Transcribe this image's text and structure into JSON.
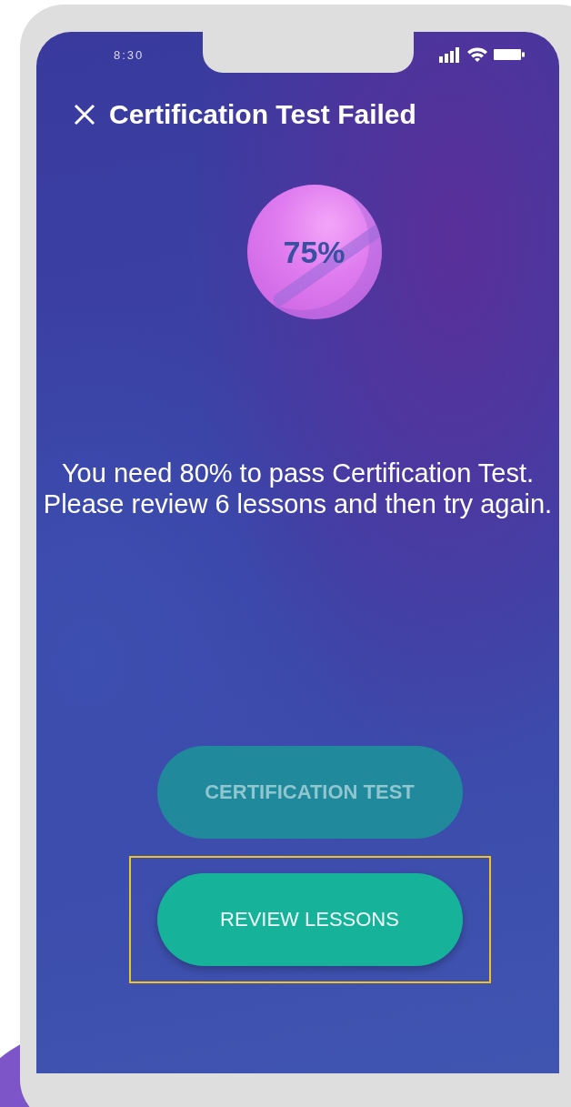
{
  "status_bar": {
    "time": "8:30"
  },
  "header": {
    "title": "Certification Test Failed"
  },
  "score": {
    "text": "75%"
  },
  "message": "You need 80% to pass Certification Test. Please review 6  lessons and then try again.",
  "buttons": [
    {
      "label": "CERTIFICATION TEST",
      "disabled": true,
      "highlighted": false
    },
    {
      "label": "REVIEW LESSONS",
      "disabled": false,
      "highlighted": true
    }
  ]
}
